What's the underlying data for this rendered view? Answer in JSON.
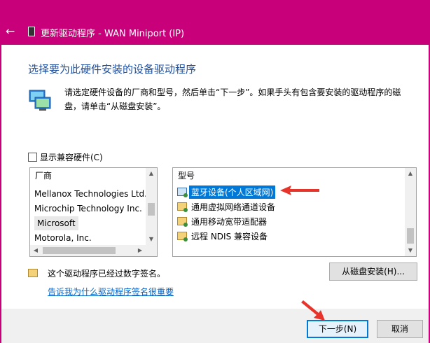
{
  "window": {
    "title": "更新驱动程序 - WAN Miniport (IP)",
    "back_glyph": "←"
  },
  "main": {
    "heading": "选择要为此硬件安装的设备驱动程序",
    "instruction": "请选定硬件设备的厂商和型号，然后单击“下一步”。如果手头有包含要安装的驱动程序的磁盘，请单击“从磁盘安装”。",
    "compat_label": "显示兼容硬件(C)",
    "compat_checked": false
  },
  "manufacturers": {
    "header": "厂商",
    "items": [
      "Mellanox Technologies Ltd.",
      "Microchip Technology Inc.",
      "Microsoft",
      "Motorola, Inc."
    ],
    "selected": "Microsoft"
  },
  "models": {
    "header": "型号",
    "items": [
      "蓝牙设备(个人区域网)",
      "通用虚拟网络通道设备",
      "通用移动宽带适配器",
      "远程 NDIS 兼容设备"
    ],
    "selected": "蓝牙设备(个人区域网)"
  },
  "signature": {
    "status": "这个驱动程序已经过数字签名。",
    "link": "告诉我为什么驱动程序签名很重要"
  },
  "buttons": {
    "have_disk": "从磁盘安装(H)...",
    "next": "下一步(N)",
    "cancel": "取消"
  },
  "colors": {
    "accent": "#c8007a",
    "heading": "#1e4e9e",
    "selection": "#0078d7",
    "link": "#0066cc",
    "annotation_arrow": "#e8332a"
  },
  "icons": [
    "back-arrow-icon",
    "device-icon",
    "network-monitor-icon",
    "driver-icon",
    "certificate-icon",
    "checkbox-icon"
  ]
}
